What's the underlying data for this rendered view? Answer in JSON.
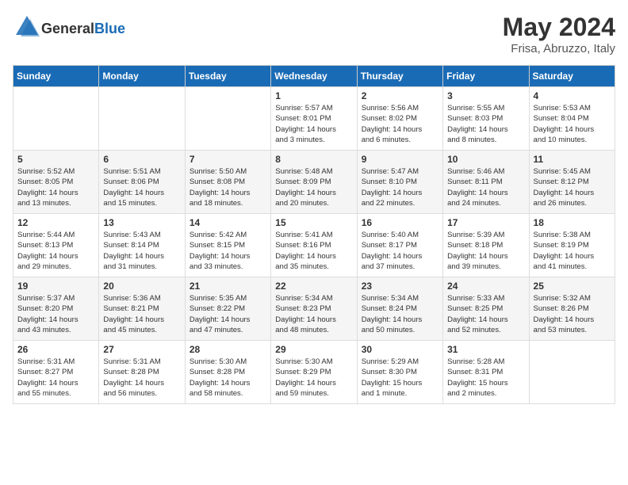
{
  "header": {
    "logo_general": "General",
    "logo_blue": "Blue",
    "month_year": "May 2024",
    "location": "Frisa, Abruzzo, Italy"
  },
  "columns": [
    "Sunday",
    "Monday",
    "Tuesday",
    "Wednesday",
    "Thursday",
    "Friday",
    "Saturday"
  ],
  "weeks": [
    {
      "days": [
        {
          "num": "",
          "info": ""
        },
        {
          "num": "",
          "info": ""
        },
        {
          "num": "",
          "info": ""
        },
        {
          "num": "1",
          "info": "Sunrise: 5:57 AM\nSunset: 8:01 PM\nDaylight: 14 hours\nand 3 minutes."
        },
        {
          "num": "2",
          "info": "Sunrise: 5:56 AM\nSunset: 8:02 PM\nDaylight: 14 hours\nand 6 minutes."
        },
        {
          "num": "3",
          "info": "Sunrise: 5:55 AM\nSunset: 8:03 PM\nDaylight: 14 hours\nand 8 minutes."
        },
        {
          "num": "4",
          "info": "Sunrise: 5:53 AM\nSunset: 8:04 PM\nDaylight: 14 hours\nand 10 minutes."
        }
      ]
    },
    {
      "days": [
        {
          "num": "5",
          "info": "Sunrise: 5:52 AM\nSunset: 8:05 PM\nDaylight: 14 hours\nand 13 minutes."
        },
        {
          "num": "6",
          "info": "Sunrise: 5:51 AM\nSunset: 8:06 PM\nDaylight: 14 hours\nand 15 minutes."
        },
        {
          "num": "7",
          "info": "Sunrise: 5:50 AM\nSunset: 8:08 PM\nDaylight: 14 hours\nand 18 minutes."
        },
        {
          "num": "8",
          "info": "Sunrise: 5:48 AM\nSunset: 8:09 PM\nDaylight: 14 hours\nand 20 minutes."
        },
        {
          "num": "9",
          "info": "Sunrise: 5:47 AM\nSunset: 8:10 PM\nDaylight: 14 hours\nand 22 minutes."
        },
        {
          "num": "10",
          "info": "Sunrise: 5:46 AM\nSunset: 8:11 PM\nDaylight: 14 hours\nand 24 minutes."
        },
        {
          "num": "11",
          "info": "Sunrise: 5:45 AM\nSunset: 8:12 PM\nDaylight: 14 hours\nand 26 minutes."
        }
      ]
    },
    {
      "days": [
        {
          "num": "12",
          "info": "Sunrise: 5:44 AM\nSunset: 8:13 PM\nDaylight: 14 hours\nand 29 minutes."
        },
        {
          "num": "13",
          "info": "Sunrise: 5:43 AM\nSunset: 8:14 PM\nDaylight: 14 hours\nand 31 minutes."
        },
        {
          "num": "14",
          "info": "Sunrise: 5:42 AM\nSunset: 8:15 PM\nDaylight: 14 hours\nand 33 minutes."
        },
        {
          "num": "15",
          "info": "Sunrise: 5:41 AM\nSunset: 8:16 PM\nDaylight: 14 hours\nand 35 minutes."
        },
        {
          "num": "16",
          "info": "Sunrise: 5:40 AM\nSunset: 8:17 PM\nDaylight: 14 hours\nand 37 minutes."
        },
        {
          "num": "17",
          "info": "Sunrise: 5:39 AM\nSunset: 8:18 PM\nDaylight: 14 hours\nand 39 minutes."
        },
        {
          "num": "18",
          "info": "Sunrise: 5:38 AM\nSunset: 8:19 PM\nDaylight: 14 hours\nand 41 minutes."
        }
      ]
    },
    {
      "days": [
        {
          "num": "19",
          "info": "Sunrise: 5:37 AM\nSunset: 8:20 PM\nDaylight: 14 hours\nand 43 minutes."
        },
        {
          "num": "20",
          "info": "Sunrise: 5:36 AM\nSunset: 8:21 PM\nDaylight: 14 hours\nand 45 minutes."
        },
        {
          "num": "21",
          "info": "Sunrise: 5:35 AM\nSunset: 8:22 PM\nDaylight: 14 hours\nand 47 minutes."
        },
        {
          "num": "22",
          "info": "Sunrise: 5:34 AM\nSunset: 8:23 PM\nDaylight: 14 hours\nand 48 minutes."
        },
        {
          "num": "23",
          "info": "Sunrise: 5:34 AM\nSunset: 8:24 PM\nDaylight: 14 hours\nand 50 minutes."
        },
        {
          "num": "24",
          "info": "Sunrise: 5:33 AM\nSunset: 8:25 PM\nDaylight: 14 hours\nand 52 minutes."
        },
        {
          "num": "25",
          "info": "Sunrise: 5:32 AM\nSunset: 8:26 PM\nDaylight: 14 hours\nand 53 minutes."
        }
      ]
    },
    {
      "days": [
        {
          "num": "26",
          "info": "Sunrise: 5:31 AM\nSunset: 8:27 PM\nDaylight: 14 hours\nand 55 minutes."
        },
        {
          "num": "27",
          "info": "Sunrise: 5:31 AM\nSunset: 8:28 PM\nDaylight: 14 hours\nand 56 minutes."
        },
        {
          "num": "28",
          "info": "Sunrise: 5:30 AM\nSunset: 8:28 PM\nDaylight: 14 hours\nand 58 minutes."
        },
        {
          "num": "29",
          "info": "Sunrise: 5:30 AM\nSunset: 8:29 PM\nDaylight: 14 hours\nand 59 minutes."
        },
        {
          "num": "30",
          "info": "Sunrise: 5:29 AM\nSunset: 8:30 PM\nDaylight: 15 hours\nand 1 minute."
        },
        {
          "num": "31",
          "info": "Sunrise: 5:28 AM\nSunset: 8:31 PM\nDaylight: 15 hours\nand 2 minutes."
        },
        {
          "num": "",
          "info": ""
        }
      ]
    }
  ]
}
